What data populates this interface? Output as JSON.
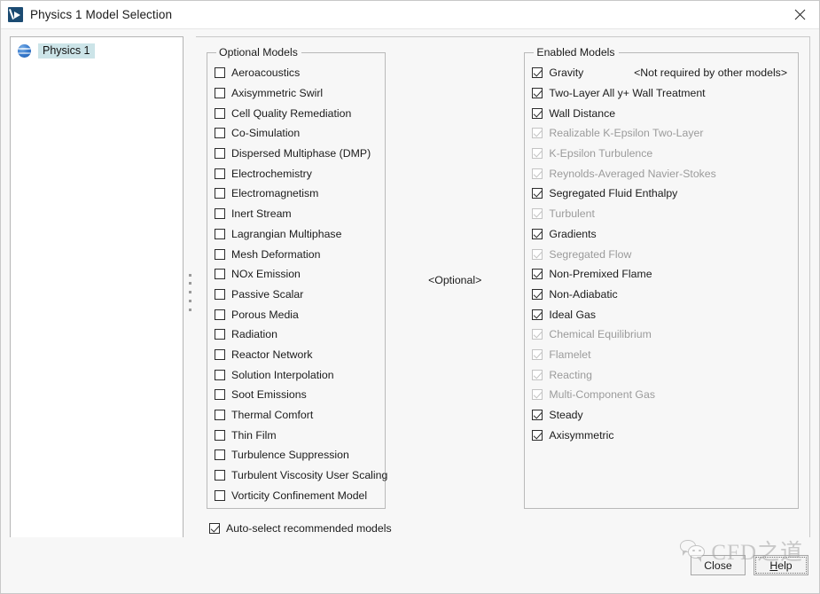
{
  "window": {
    "title": "Physics 1 Model Selection",
    "icon": "physics-model-icon",
    "close_icon": "close-icon"
  },
  "tree": {
    "items": [
      {
        "label": "Physics 1",
        "icon": "physics-sphere-icon",
        "selected": true
      }
    ]
  },
  "optional_group": {
    "legend": "Optional Models",
    "items": [
      {
        "label": "Aeroacoustics",
        "checked": false,
        "enabled": true
      },
      {
        "label": "Axisymmetric Swirl",
        "checked": false,
        "enabled": true
      },
      {
        "label": "Cell Quality Remediation",
        "checked": false,
        "enabled": true
      },
      {
        "label": "Co-Simulation",
        "checked": false,
        "enabled": true
      },
      {
        "label": "Dispersed Multiphase (DMP)",
        "checked": false,
        "enabled": true
      },
      {
        "label": "Electrochemistry",
        "checked": false,
        "enabled": true
      },
      {
        "label": "Electromagnetism",
        "checked": false,
        "enabled": true
      },
      {
        "label": "Inert Stream",
        "checked": false,
        "enabled": true
      },
      {
        "label": "Lagrangian Multiphase",
        "checked": false,
        "enabled": true
      },
      {
        "label": "Mesh Deformation",
        "checked": false,
        "enabled": true
      },
      {
        "label": "NOx Emission",
        "checked": false,
        "enabled": true
      },
      {
        "label": "Passive Scalar",
        "checked": false,
        "enabled": true
      },
      {
        "label": "Porous Media",
        "checked": false,
        "enabled": true
      },
      {
        "label": "Radiation",
        "checked": false,
        "enabled": true
      },
      {
        "label": "Reactor Network",
        "checked": false,
        "enabled": true
      },
      {
        "label": "Solution Interpolation",
        "checked": false,
        "enabled": true
      },
      {
        "label": "Soot Emissions",
        "checked": false,
        "enabled": true
      },
      {
        "label": "Thermal Comfort",
        "checked": false,
        "enabled": true
      },
      {
        "label": "Thin Film",
        "checked": false,
        "enabled": true
      },
      {
        "label": "Turbulence Suppression",
        "checked": false,
        "enabled": true
      },
      {
        "label": "Turbulent Viscosity User Scaling",
        "checked": false,
        "enabled": true
      },
      {
        "label": "Vorticity Confinement Model",
        "checked": false,
        "enabled": true
      }
    ]
  },
  "optional_note": "<Optional>",
  "enabled_group": {
    "legend": "Enabled Models",
    "items": [
      {
        "label": "Gravity",
        "checked": true,
        "enabled": true,
        "note": "<Not required by other models>"
      },
      {
        "label": "Two-Layer All y+ Wall Treatment",
        "checked": true,
        "enabled": true,
        "note": ""
      },
      {
        "label": "Wall Distance",
        "checked": true,
        "enabled": true,
        "note": ""
      },
      {
        "label": "Realizable K-Epsilon Two-Layer",
        "checked": true,
        "enabled": false,
        "note": ""
      },
      {
        "label": "K-Epsilon Turbulence",
        "checked": true,
        "enabled": false,
        "note": ""
      },
      {
        "label": "Reynolds-Averaged Navier-Stokes",
        "checked": true,
        "enabled": false,
        "note": ""
      },
      {
        "label": "Segregated Fluid Enthalpy",
        "checked": true,
        "enabled": true,
        "note": ""
      },
      {
        "label": "Turbulent",
        "checked": true,
        "enabled": false,
        "note": ""
      },
      {
        "label": "Gradients",
        "checked": true,
        "enabled": true,
        "note": ""
      },
      {
        "label": "Segregated Flow",
        "checked": true,
        "enabled": false,
        "note": ""
      },
      {
        "label": "Non-Premixed Flame",
        "checked": true,
        "enabled": true,
        "note": ""
      },
      {
        "label": "Non-Adiabatic",
        "checked": true,
        "enabled": true,
        "note": ""
      },
      {
        "label": "Ideal Gas",
        "checked": true,
        "enabled": true,
        "note": ""
      },
      {
        "label": "Chemical Equilibrium",
        "checked": true,
        "enabled": false,
        "note": ""
      },
      {
        "label": "Flamelet",
        "checked": true,
        "enabled": false,
        "note": ""
      },
      {
        "label": "Reacting",
        "checked": true,
        "enabled": false,
        "note": ""
      },
      {
        "label": "Multi-Component Gas",
        "checked": true,
        "enabled": false,
        "note": ""
      },
      {
        "label": "Steady",
        "checked": true,
        "enabled": true,
        "note": ""
      },
      {
        "label": "Axisymmetric",
        "checked": true,
        "enabled": true,
        "note": ""
      }
    ]
  },
  "auto_select": {
    "label": "Auto-select recommended models",
    "checked": true
  },
  "footer": {
    "close_label": "Close",
    "help_label": "Help",
    "help_mnemonic": "H",
    "help_rest": "elp"
  },
  "watermark": {
    "text": "CFD之道",
    "logo": "wechat-bubbles-icon"
  },
  "colors": {
    "selection_highlight": "#cce4e8",
    "sphere_blue": "#3d7fd0",
    "disabled_text": "#9b9b9b",
    "border": "#b9b9b9",
    "window_bg": "#f7f7f7",
    "watermark": "#a3a3a3"
  }
}
